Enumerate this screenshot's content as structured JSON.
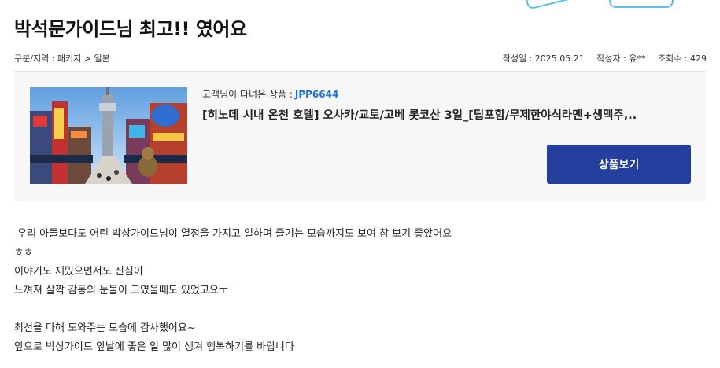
{
  "title": "박석문가이드님 최고!! 였어요",
  "meta": {
    "category": "구분/지역 : 패키지 > 일본",
    "date": "작성일 : 2025.05.21",
    "author": "작성자 : 유**",
    "views": "조회수 : 429"
  },
  "product": {
    "visited_label": "고객님이 다녀온 상품 :",
    "code": "JPP6644",
    "name": "[히노데 시내 온천 호텔] 오사카/교토/고베 롯코산 3일_[팁포함/무제한야식라멘+생맥주,..",
    "button_label": "상품보기",
    "image_alt": "osaka-street-photo"
  },
  "review_lines": [
    " 우리 아들보다도 어린 박상가이드님이 열정을 가지고 일하며 즐기는 모습까지도 보여 참 보기 좋았어요",
    "ㅎㅎ",
    "이야기도 재밌으면서도 진심이",
    "느껴져 살짝 감동의 눈물이 고였을때도 있었고요ㅜ",
    "",
    "최선을 다해 도와주는 모습에 감사했어요~",
    "앞으로 박상가이드 앞날에 좋은 일 많이 생겨 행복하기를 바랍니다"
  ],
  "colors": {
    "accent_blue": "#1a73d9",
    "button_bg": "#243f9e",
    "box_bg": "#f7f7f7",
    "deco": "#58c0ea"
  }
}
